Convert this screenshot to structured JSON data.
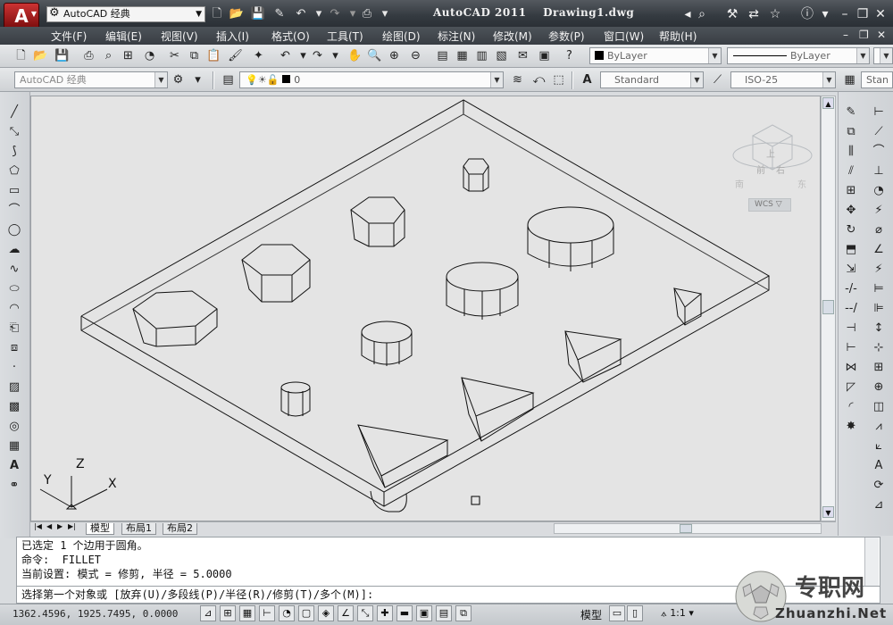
{
  "title": {
    "app_logo": "A",
    "workspace": "AutoCAD 经典",
    "window_title": "AutoCAD 2011    Drawing1.dwg"
  },
  "menu": {
    "items": [
      "文件(F)",
      "编辑(E)",
      "视图(V)",
      "插入(I)",
      "格式(O)",
      "工具(T)",
      "绘图(D)",
      "标注(N)",
      "修改(M)",
      "参数(P)",
      "窗口(W)",
      "帮助(H)"
    ]
  },
  "toolbar": {
    "workspace2": "AutoCAD 经典",
    "layer_value": "0",
    "color_value": "ByLayer",
    "linetype_value": "ByLayer",
    "textstyle": "Standard",
    "dimstyle": "ISO-25",
    "tablestyle": "Stan"
  },
  "viewcube": {
    "wcs_label": "WCS",
    "face_top": "上",
    "face_front": "前",
    "face_right": "右"
  },
  "ucs": {
    "x_label": "X",
    "y_label": "Y",
    "z_label": "Z"
  },
  "tabs": [
    "模型",
    "布局1",
    "布局2"
  ],
  "command": {
    "lines": [
      "已选定 1 个边用于圆角。",
      "命令:  FILLET",
      "当前设置: 模式 = 修剪, 半径 = 5.0000"
    ],
    "prompt": "选择第一个对象或 [放弃(U)/多段线(P)/半径(R)/修剪(T)/多个(M)]:"
  },
  "status": {
    "coordinates": "1362.4596, 1925.7495, 0.0000",
    "model_label": "模型",
    "scale_label": "1:1"
  },
  "watermark": {
    "text": "专职网",
    "url": "Zhuanzhi.Net"
  },
  "colors": {
    "title_bg": "#3a3f45",
    "viewport_bg": "#e4e4e4",
    "drawing_line": "#111111",
    "accent_red": "#b52020"
  },
  "icons": {
    "left_toolbar": [
      "line-icon",
      "construction-line-icon",
      "polyline-icon",
      "polygon-icon",
      "rectangle-icon",
      "arc-icon",
      "circle-icon",
      "revcloud-icon",
      "spline-icon",
      "ellipse-icon",
      "ellipse-arc-icon",
      "insert-block-icon",
      "make-block-icon",
      "point-icon",
      "hatch-icon",
      "gradient-icon",
      "region-icon",
      "table-icon",
      "mtext-icon",
      "add-selected-icon"
    ],
    "right_toolbar": [
      "erase-icon",
      "copy-icon",
      "mirror-icon",
      "offset-icon",
      "array-icon",
      "move-icon",
      "rotate-icon",
      "scale-icon",
      "stretch-icon",
      "trim-icon",
      "extend-icon",
      "break-point-icon",
      "break-icon",
      "join-icon",
      "chamfer-icon",
      "fillet-icon",
      "explode-icon"
    ]
  }
}
